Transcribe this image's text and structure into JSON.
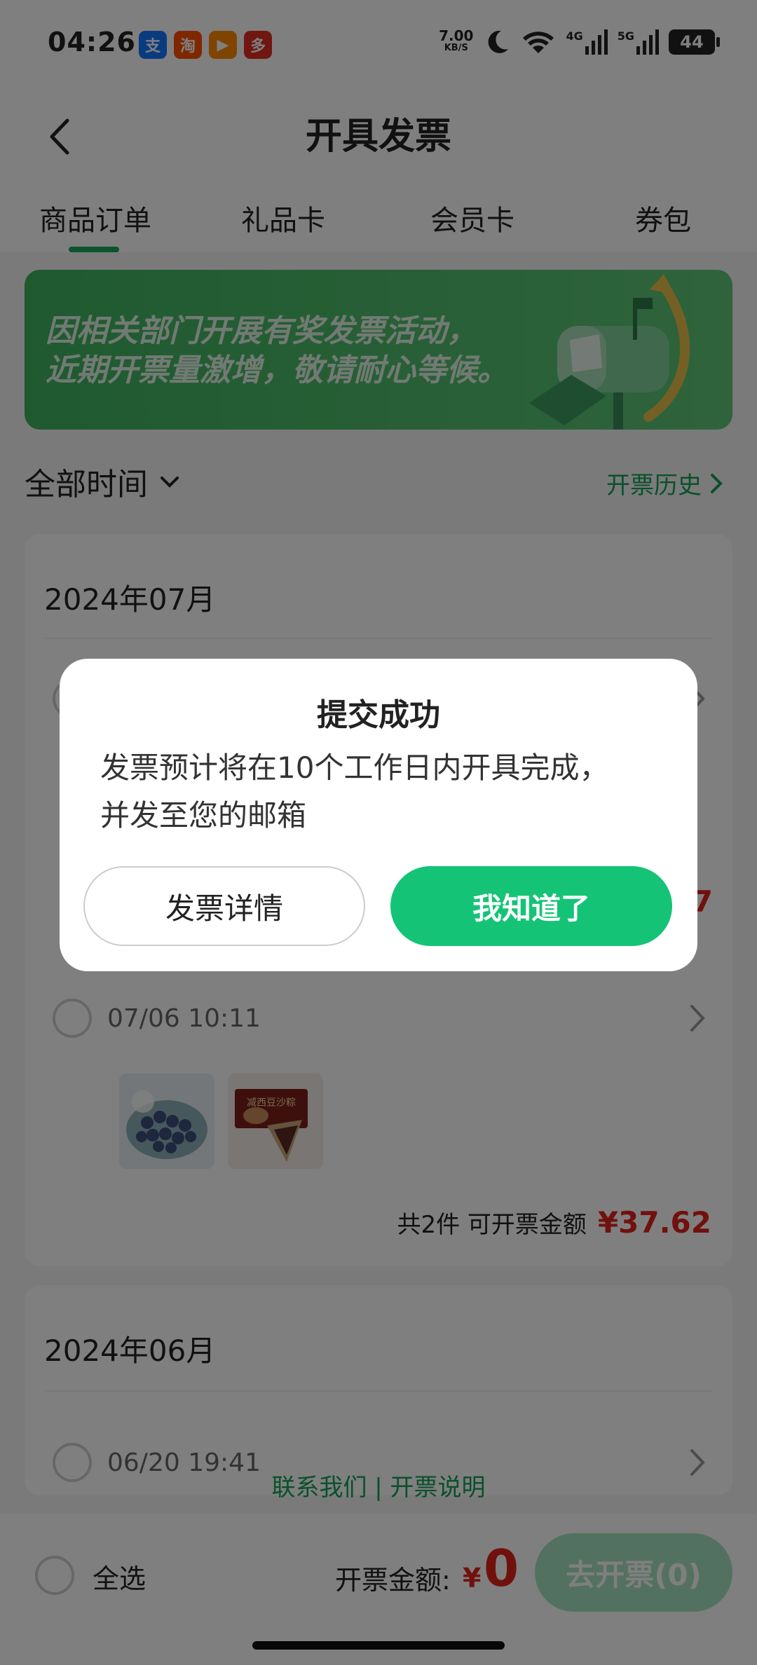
{
  "status_bar": {
    "time": "04:26",
    "net_speed": "7.00",
    "net_speed_unit": "KB/S",
    "signal_1": "4G",
    "signal_2": "5G",
    "battery": "44",
    "app_icons": [
      {
        "name": "alipay-icon",
        "glyph": "支",
        "color": "#1677ff"
      },
      {
        "name": "taobao-icon",
        "glyph": "淘",
        "color": "#ff5000"
      },
      {
        "name": "app-icon",
        "glyph": "▶",
        "color": "#ff8a00"
      },
      {
        "name": "pinduoduo-icon",
        "glyph": "多",
        "color": "#e02e24"
      }
    ]
  },
  "header": {
    "title": "开具发票",
    "tabs": [
      "商品订单",
      "礼品卡",
      "会员卡",
      "券包"
    ]
  },
  "banner": {
    "line1": "因相关部门开展有奖发票活动，",
    "line2": "近期开票量激增，敬请耐心等候。"
  },
  "filter": {
    "time_range": "全部时间",
    "history_link": "开票历史"
  },
  "orders": {
    "group_july": {
      "month": "2024年07月",
      "peek_amount_fragment": "7",
      "order2": {
        "time": "07/06 10:11",
        "summary_count": "共2件",
        "summary_label": "可开票金额",
        "amount": "¥37.62",
        "thumb_label": "减西豆沙粽"
      }
    },
    "group_june": {
      "month": "2024年06月",
      "order1_time": "06/20 19:41"
    }
  },
  "footer": {
    "contact": "联系我们",
    "separator": "|",
    "explain": "开票说明"
  },
  "bottom_bar": {
    "select_all": "全选",
    "amount_label": "开票金额:",
    "currency": "¥",
    "amount": "0",
    "submit": "去开票(0)"
  },
  "dialog": {
    "title": "提交成功",
    "message_line1": "发票预计将在10个工作日内开具完成，",
    "message_line2": "并发至您的邮箱",
    "secondary_button": "发票详情",
    "primary_button": "我知道了"
  }
}
